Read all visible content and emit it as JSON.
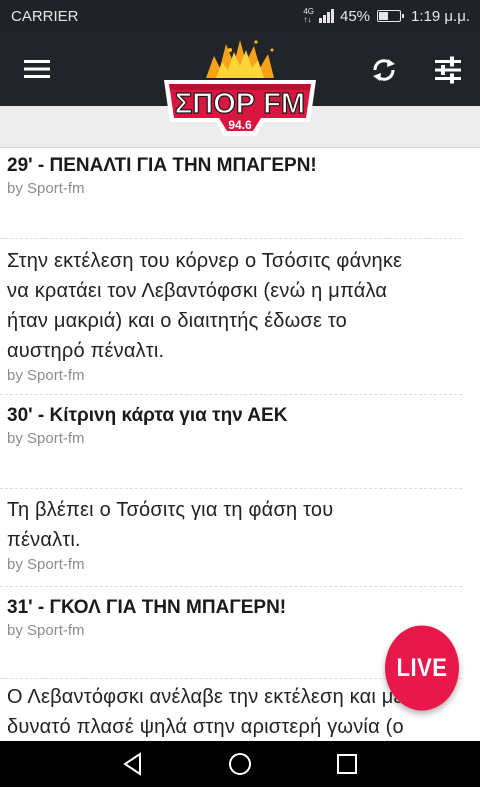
{
  "status_bar": {
    "carrier": "CARRIER",
    "network_top": "4G",
    "network_bottom": "↑↓",
    "battery": "45%",
    "battery_level": 0.45,
    "time": "1:19 μ.μ."
  },
  "app_bar": {
    "logo_text": "ΣΠΟΡ FM",
    "logo_frequency": "94.6",
    "menu_icon": "hamburger-menu-icon",
    "refresh_icon": "refresh-icon",
    "filter_icon": "sliders-icon"
  },
  "feed": {
    "entries": [
      {
        "title": "29' - ΠΕΝΑΛΤΙ ΓΙΑ ΤΗΝ ΜΠΑΓΕΡΝ!",
        "byline": "by Sport-fm"
      },
      {
        "body": [
          "Στην εκτέλεση του κόρνερ ο Τσόσιτς φάνηκε",
          "να κρατάει τον Λεβαντόφσκι (ενώ η μπάλα",
          "ήταν μακριά) και ο διαιτητής έδωσε το",
          "αυστηρό πέναλτι."
        ],
        "byline": "by Sport-fm"
      },
      {
        "title": "30' - Κίτρινη κάρτα για την ΑΕΚ",
        "byline": "by Sport-fm"
      },
      {
        "body": [
          "Τη βλέπει ο Τσόσιτς για τη φάση του",
          "πέναλτι."
        ],
        "byline": "by Sport-fm"
      },
      {
        "title": "31' - ΓΚΟΛ ΓΙΑ ΤΗΝ ΜΠΑΓΕΡΝ!",
        "byline": "by Sport-fm"
      },
      {
        "body": [
          "Ο Λεβαντόφσκι ανέλαβε την εκτέλεση και με",
          "δυνατό πλασέ ψηλά στην αριστερή γωνία (ο"
        ]
      }
    ]
  },
  "live_button": {
    "label": "LIVE",
    "color": "#e8184a"
  },
  "nav_bar": {
    "back_icon": "back-triangle-icon",
    "home_icon": "home-circle-icon",
    "recents_icon": "recents-square-icon"
  },
  "colors": {
    "app_bar": "#212529",
    "status_bar": "#1f2229",
    "logo_red": "#d9163f",
    "logo_yellow": "#f7c11a"
  }
}
